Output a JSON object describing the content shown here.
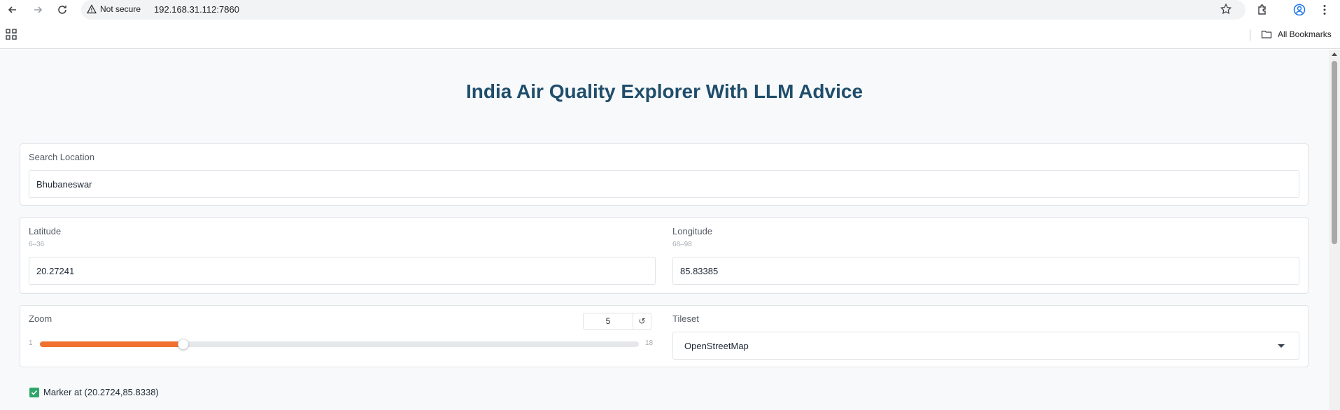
{
  "browser": {
    "security_label": "Not secure",
    "url": "192.168.31.112:7860",
    "bookmarks_label": "All Bookmarks"
  },
  "app": {
    "title": "India Air Quality Explorer With LLM Advice"
  },
  "search": {
    "label": "Search Location",
    "value": "Bhubaneswar"
  },
  "latitude": {
    "label": "Latitude",
    "hint": "6–36",
    "value": "20.27241"
  },
  "longitude": {
    "label": "Longitude",
    "hint": "68–98",
    "value": "85.83385"
  },
  "zoom": {
    "label": "Zoom",
    "value": "5",
    "min": "1",
    "max": "18",
    "fraction": 0.24
  },
  "tileset": {
    "label": "Tileset",
    "value": "OpenStreetMap"
  },
  "marker": {
    "label": "Marker at (20.2724,85.8338)",
    "checked": true
  },
  "colors": {
    "accent": "#f07030",
    "title": "#1f4e6b",
    "checkbox": "#2ea66a"
  }
}
